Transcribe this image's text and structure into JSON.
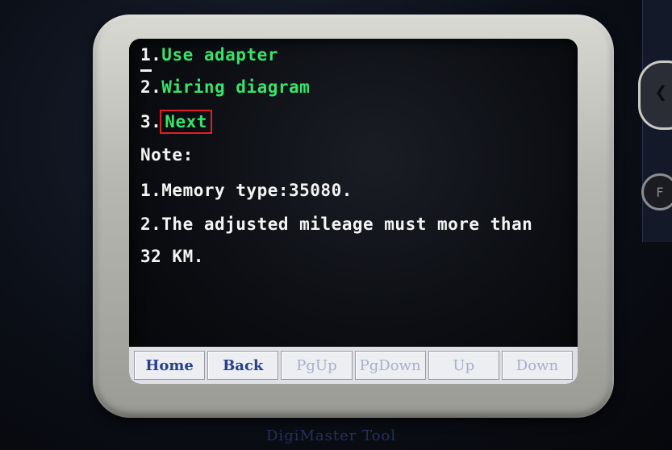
{
  "menu": {
    "items": [
      {
        "num": "1.",
        "label": "Use adapter"
      },
      {
        "num": "2.",
        "label": "Wiring diagram"
      },
      {
        "num": "3.",
        "label": "Next"
      }
    ]
  },
  "note": {
    "heading": "Note:",
    "lines": [
      "1.Memory type:35080.",
      "2.The adjusted mileage must more than",
      "32 KM."
    ]
  },
  "toolbar": {
    "home": "Home",
    "back": "Back",
    "pgup": "PgUp",
    "pgdown": "PgDown",
    "up": "Up",
    "down": "Down"
  },
  "brand": "DigiMaster Tool",
  "colors": {
    "menu_text": "#39e36a",
    "note_text": "#f4f4f4",
    "highlight_box": "#e0201c",
    "toolbar_bg": "#dfe0e6"
  },
  "side_button_label": "F"
}
